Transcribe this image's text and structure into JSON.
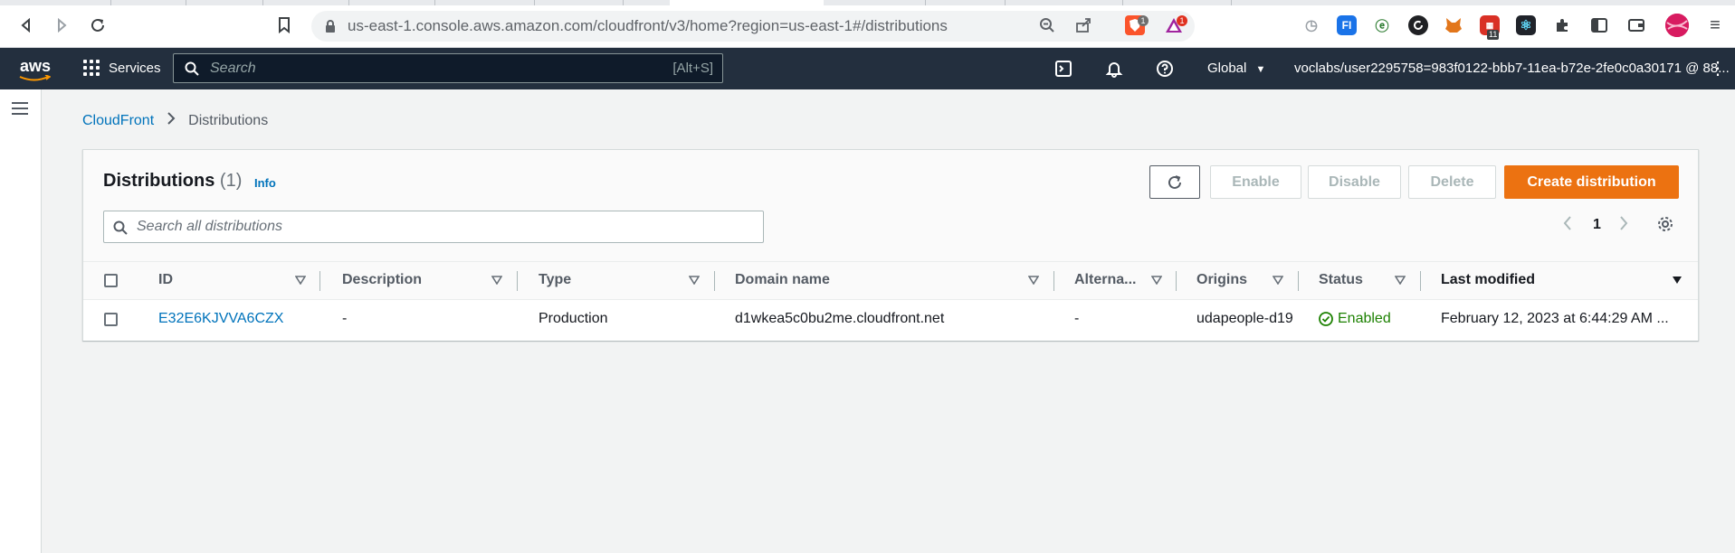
{
  "browser": {
    "url": "us-east-1.console.aws.amazon.com/cloudfront/v3/home?region=us-east-1#/distributions",
    "extension_badges": [
      "1",
      "1"
    ],
    "calendar_badge": "11"
  },
  "aws_nav": {
    "logo_text": "aws",
    "services_label": "Services",
    "search_placeholder": "Search",
    "search_shortcut": "[Alt+S]",
    "region_label": "Global",
    "account_label": "voclabs/user2295758=983f0122-bbb7-11ea-b72e-2fe0c0a30171 @ 88..."
  },
  "breadcrumb": {
    "root": "CloudFront",
    "current": "Distributions"
  },
  "panel": {
    "title": "Distributions",
    "count": "(1)",
    "info_label": "Info",
    "buttons": {
      "enable": "Enable",
      "disable": "Disable",
      "delete": "Delete",
      "create": "Create distribution"
    },
    "search_placeholder": "Search all distributions",
    "page_number": "1"
  },
  "table": {
    "columns": [
      "ID",
      "Description",
      "Type",
      "Domain name",
      "Alterna...",
      "Origins",
      "Status",
      "Last modified"
    ],
    "rows": [
      {
        "id": "E32E6KJVVA6CZX",
        "description": "-",
        "type": "Production",
        "domain_name": "d1wkea5c0bu2me.cloudfront.net",
        "alternate": "-",
        "origins": "udapeople-d19",
        "status": "Enabled",
        "last_modified": "February 12, 2023 at 6:44:29 AM ..."
      }
    ]
  },
  "colors": {
    "aws_nav_bg": "#232f3e",
    "primary_button": "#ec7211",
    "link": "#0073bb",
    "status_ok": "#1d8102"
  }
}
